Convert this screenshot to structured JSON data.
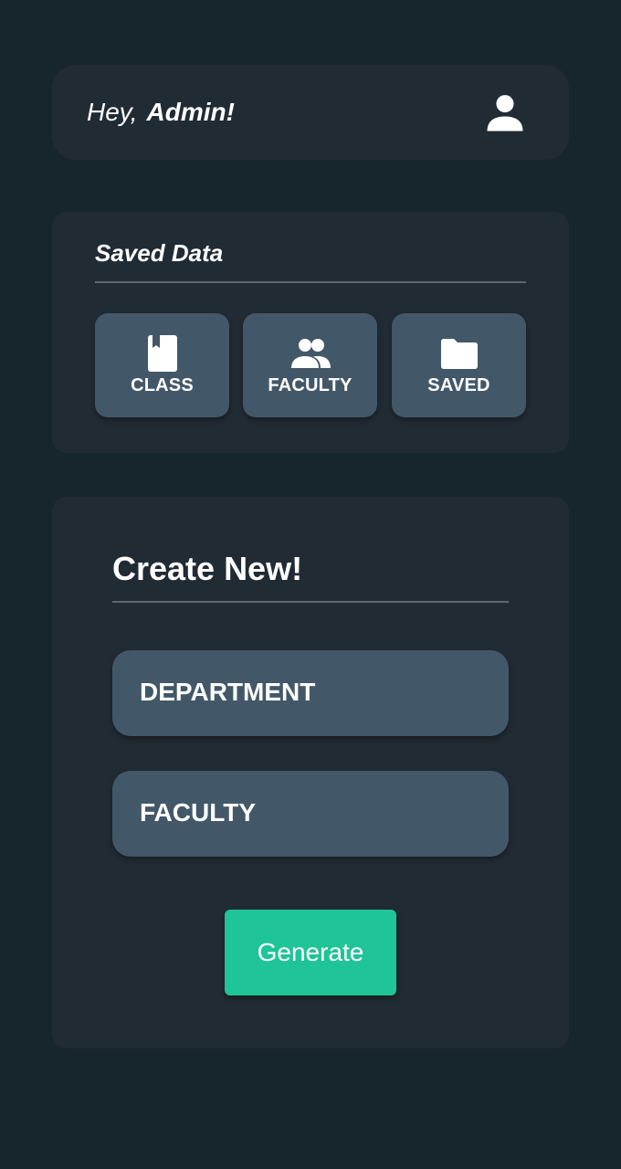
{
  "greeting": {
    "prefix": "Hey,",
    "name": "Admin!",
    "avatar_icon": "person-icon"
  },
  "saved_data": {
    "title": "Saved Data",
    "tiles": [
      {
        "label": "CLASS",
        "icon": "book-icon"
      },
      {
        "label": "FACULTY",
        "icon": "people-icon"
      },
      {
        "label": "SAVED",
        "icon": "folder-icon"
      }
    ]
  },
  "create_new": {
    "title": "Create New!",
    "options": [
      "DEPARTMENT",
      "FACULTY"
    ],
    "button_label": "Generate"
  },
  "colors": {
    "background": "#17252d",
    "card": "#212b34",
    "tile": "#425868",
    "accent": "#1fc497"
  }
}
